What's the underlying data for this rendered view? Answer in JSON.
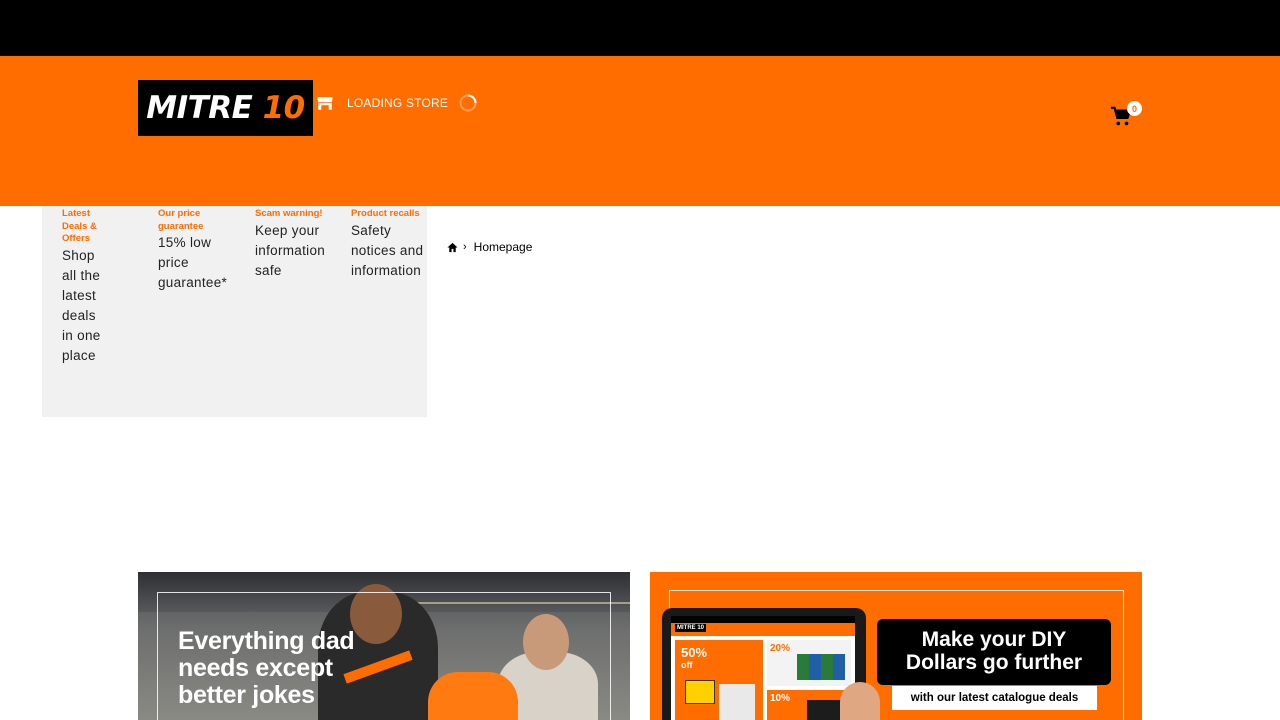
{
  "header": {
    "logo": {
      "text_main": "MITRE ",
      "text_num": "10"
    },
    "store": {
      "label": "LOADING STORE",
      "icon": "store-icon"
    },
    "cart": {
      "count": "0",
      "icon": "cart-icon"
    }
  },
  "promo": {
    "items": [
      {
        "title": "Latest Deals & Offers",
        "desc": "Shop all the latest deals in one place"
      },
      {
        "title": "Our price guarantee",
        "desc": "15% low price guarantee*"
      },
      {
        "title": "Scam warning!",
        "desc": "Keep your information safe"
      },
      {
        "title": "Product recalls",
        "desc": "Safety notices and information"
      }
    ]
  },
  "breadcrumb": {
    "separator": "›",
    "current": "Homepage",
    "icon": "home-icon"
  },
  "banners": {
    "left": {
      "heading_line1": "Everything dad",
      "heading_line2": "needs except",
      "heading_line3": "better jokes"
    },
    "right": {
      "heading_line1": "Make your DIY",
      "heading_line2": "Dollars go further",
      "subtext": "with our latest catalogue deals",
      "tablet_logo": "MITRE 10",
      "tablet_deal1_pct": "50%",
      "tablet_deal1_word": "off",
      "tablet_deal2": "20%",
      "tablet_deal3": "10%"
    }
  },
  "colors": {
    "brand_orange": "#ff6c00",
    "black": "#000000",
    "panel_gray": "#f1f1f1"
  }
}
